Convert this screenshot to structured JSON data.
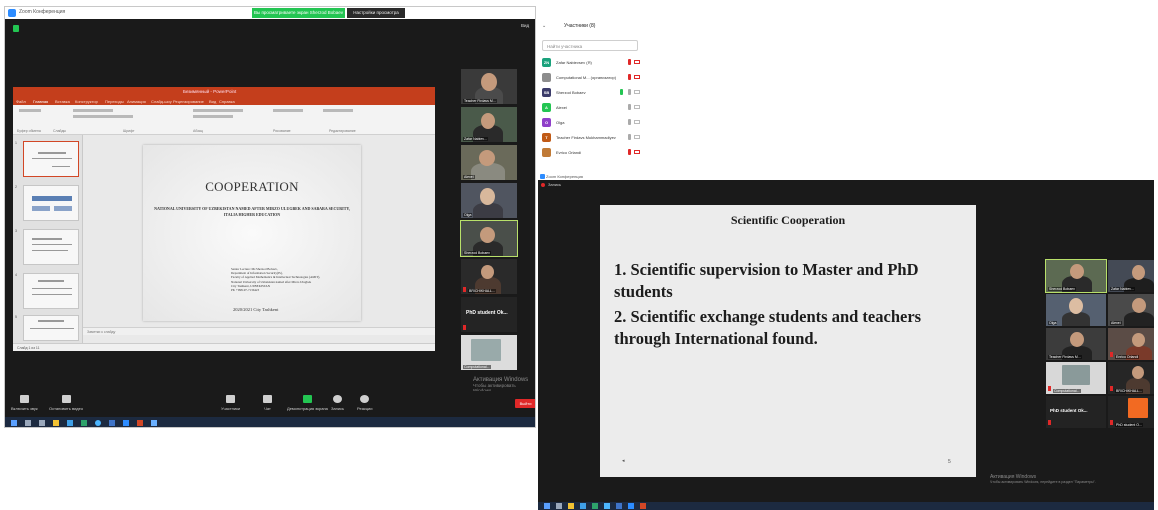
{
  "left_window": {
    "app_title": "Zoom Конференция",
    "share_banner": "Вы просматриваете экран Sherzod Bobaev",
    "share_options": "Настройки просмотра",
    "view_label": "Вид",
    "ppt": {
      "window_title": "Безимянный - PowerPoint",
      "tabs": [
        "Файл",
        "Главная",
        "Вставка",
        "Конструктор",
        "Переходы",
        "Анимация",
        "Слайд-шоу",
        "Рецензирование",
        "Вид",
        "Справка"
      ],
      "groups": [
        "Буфер обмена",
        "Слайды",
        "Шрифт",
        "Абзац",
        "Рисование",
        "Редактирование"
      ],
      "slide": {
        "title": "COOPERATION",
        "subtitle": "NATIONAL UNIVERSITY OF UZBEKISTAN NAMED AFTER MIRZO ULUGBEK AND SABARA SECURITY, ITALIA HIGHER EDUCATION",
        "author_lines": [
          "Senior Lecture: Mr.Sherzod Bobaev,",
          "Department of Information Security(IS),",
          "Faculty of Applied Mathematics & Intellectual Technologies (AMIT),",
          "National University of Uzbekistan named after Mirzo Ulugbek",
          "City Tashkent, UZBEKISTAN",
          "Ph: +998-97-7136423"
        ],
        "date_city": "2020/2021   City Tashkent"
      },
      "notes_placeholder": "Заметки к слайду",
      "status": "Слайд 1 из 11"
    },
    "participants": [
      {
        "name": "Teacher Firdavs M..."
      },
      {
        "name": "Zafar Nabiev..."
      },
      {
        "name": "Alexei"
      },
      {
        "name": "Olga"
      },
      {
        "name": "Sherzod Bobaev"
      },
      {
        "name": "BRICHIKHALL..."
      },
      {
        "name": "PhD student Ok..."
      },
      {
        "name": "Computational..."
      }
    ],
    "controls": [
      "Включить звук",
      "Остановить видео",
      "Участники",
      "Чат",
      "Демонстрация экрана",
      "Запись",
      "Реакции"
    ],
    "leave": "Выйти",
    "activate_line1": "Активация Windows",
    "activate_line2": "Чтобы активировать Windows"
  },
  "panel": {
    "title": "Участники (8)",
    "search_placeholder": "Найти участника",
    "rows": [
      {
        "initials": "ZN",
        "name": "Zafar Nabievsev (Я)",
        "color": "#1aa27c"
      },
      {
        "initials": "",
        "name": "Computational M... (организатор)",
        "color": "#8d8d8d"
      },
      {
        "initials": "SB",
        "name": "Sherzod Bobaev",
        "color": "#3c3c6a"
      },
      {
        "initials": "A",
        "name": "Alexei",
        "color": "#23c552"
      },
      {
        "initials": "O",
        "name": "Olga",
        "color": "#8f3fc9"
      },
      {
        "initials": "T",
        "name": "Teacher Firdavs Mukhammadiyev",
        "color": "#c05a16"
      },
      {
        "initials": "",
        "name": "Evrico Orlandi",
        "color": "#c07a36"
      }
    ]
  },
  "right_window": {
    "app_title": "Zoom Конференция",
    "recording": "Запись",
    "slide_title": "Scientific Cooperation",
    "points": [
      "1. Scientific supervision to Master and PhD students",
      "2. Scientific exchange students and teachers through International found."
    ],
    "page_num": "5",
    "participants": [
      {
        "name": "Sherzod Bobaev"
      },
      {
        "name": "Zafar Nabiev..."
      },
      {
        "name": "Olga"
      },
      {
        "name": "Alexei"
      },
      {
        "name": "Teacher Firdavs M..."
      },
      {
        "name": "Enrico Orlandi"
      },
      {
        "name": "Computational..."
      },
      {
        "name": "BRICHIKHALL..."
      },
      {
        "name": "PhD student Ok..."
      },
      {
        "name": "PhD student O..."
      }
    ],
    "activate_line1": "Активация Windows",
    "activate_line2": "Чтобы активировать Windows, перейдите в раздел \"Параметры\"."
  }
}
